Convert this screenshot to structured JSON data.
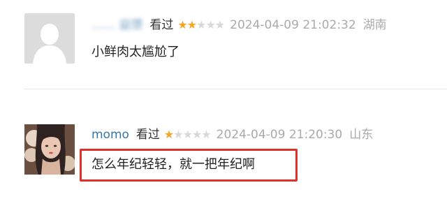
{
  "comments": [
    {
      "username": "…… 益馈",
      "action": "看过",
      "rating": 2,
      "max_rating": 5,
      "timestamp": "2024-04-09 21:02:32",
      "location": "湖南",
      "text": "小鲜肉太尴尬了",
      "avatar": "default-user-avatar"
    },
    {
      "username": "momo",
      "action": "看过",
      "rating": 1,
      "max_rating": 5,
      "timestamp": "2024-04-09 21:20:30",
      "location": "山东",
      "text": "怎么年纪轻轻，就一把年纪啊",
      "avatar": "user-photo-avatar"
    }
  ],
  "colors": {
    "username": "#3377aa",
    "star_filled": "#f7a623",
    "star_empty": "#d8d8d8",
    "highlight_border": "#e0302a"
  }
}
